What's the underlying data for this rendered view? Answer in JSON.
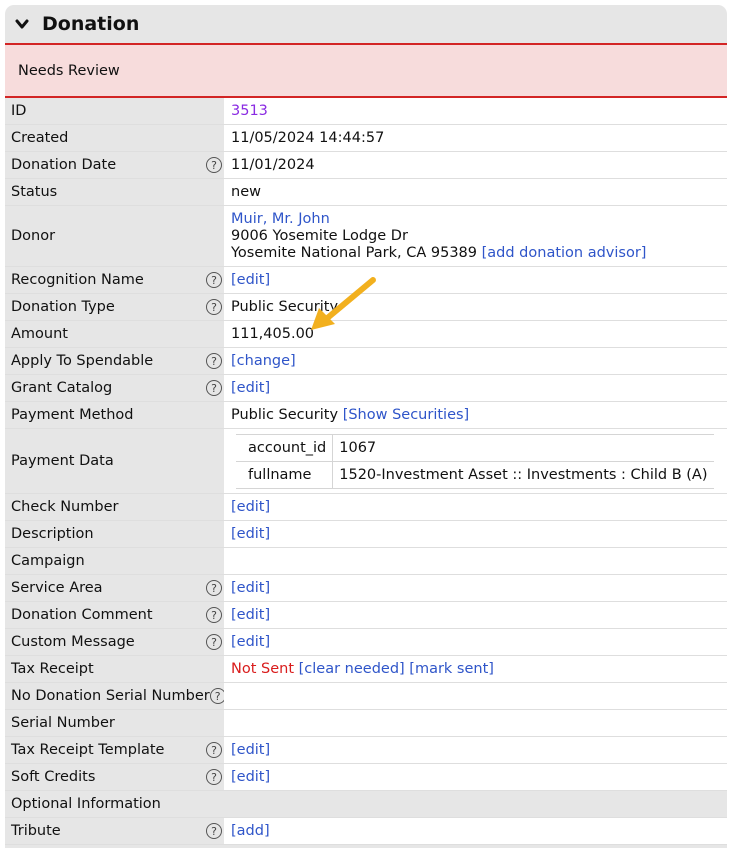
{
  "section": {
    "title": "Donation",
    "status_banner": "Needs Review"
  },
  "fields": {
    "id": {
      "label": "ID",
      "value": "3513"
    },
    "created": {
      "label": "Created",
      "value": "11/05/2024 14:44:57"
    },
    "donation_date": {
      "label": "Donation Date",
      "value": "11/01/2024"
    },
    "status": {
      "label": "Status",
      "value": "new"
    },
    "donor": {
      "label": "Donor",
      "name": "Muir, Mr. John",
      "address1": "9006 Yosemite Lodge Dr",
      "address2": "Yosemite National Park, CA 95389",
      "advisor_link": "[add donation advisor]"
    },
    "recognition_name": {
      "label": "Recognition Name",
      "action": "[edit]"
    },
    "donation_type": {
      "label": "Donation Type",
      "value": "Public Security"
    },
    "amount": {
      "label": "Amount",
      "value": "111,405.00"
    },
    "apply_to_spendable": {
      "label": "Apply To Spendable",
      "action": "[change]"
    },
    "grant_catalog": {
      "label": "Grant Catalog",
      "action": "[edit]"
    },
    "payment_method": {
      "label": "Payment Method",
      "value": "Public Security",
      "action": "[Show Securities]"
    },
    "payment_data": {
      "label": "Payment Data",
      "rows": [
        {
          "key": "account_id",
          "value": "1067"
        },
        {
          "key": "fullname",
          "value": "1520-Investment Asset :: Investments : Child B (A)"
        }
      ]
    },
    "check_number": {
      "label": "Check Number",
      "action": "[edit]"
    },
    "description": {
      "label": "Description",
      "action": "[edit]"
    },
    "campaign": {
      "label": "Campaign"
    },
    "service_area": {
      "label": "Service Area",
      "action": "[edit]"
    },
    "donation_comment": {
      "label": "Donation Comment",
      "action": "[edit]"
    },
    "custom_message": {
      "label": "Custom Message",
      "action": "[edit]"
    },
    "tax_receipt": {
      "label": "Tax Receipt",
      "status": "Not Sent",
      "clear_action": "[clear needed]",
      "mark_action": "[mark sent]"
    },
    "no_donation_serial": {
      "label": "No Donation Serial Number"
    },
    "serial_number": {
      "label": "Serial Number"
    },
    "tax_receipt_template": {
      "label": "Tax Receipt Template",
      "action": "[edit]"
    },
    "soft_credits": {
      "label": "Soft Credits",
      "action": "[edit]"
    },
    "optional_information": {
      "label": "Optional Information"
    },
    "tribute": {
      "label": "Tribute",
      "action": "[add]"
    }
  },
  "help_glyph": "?",
  "icons": {
    "collapse": "chevron-down-icon",
    "help": "help-circle-icon",
    "annotation": "arrow-icon"
  },
  "colors": {
    "link": "#2f55c9",
    "visited_link": "#8a2be2",
    "alert": "#d91c1c",
    "banner": "#f7dcdc",
    "arrow": "#f2b01e"
  }
}
